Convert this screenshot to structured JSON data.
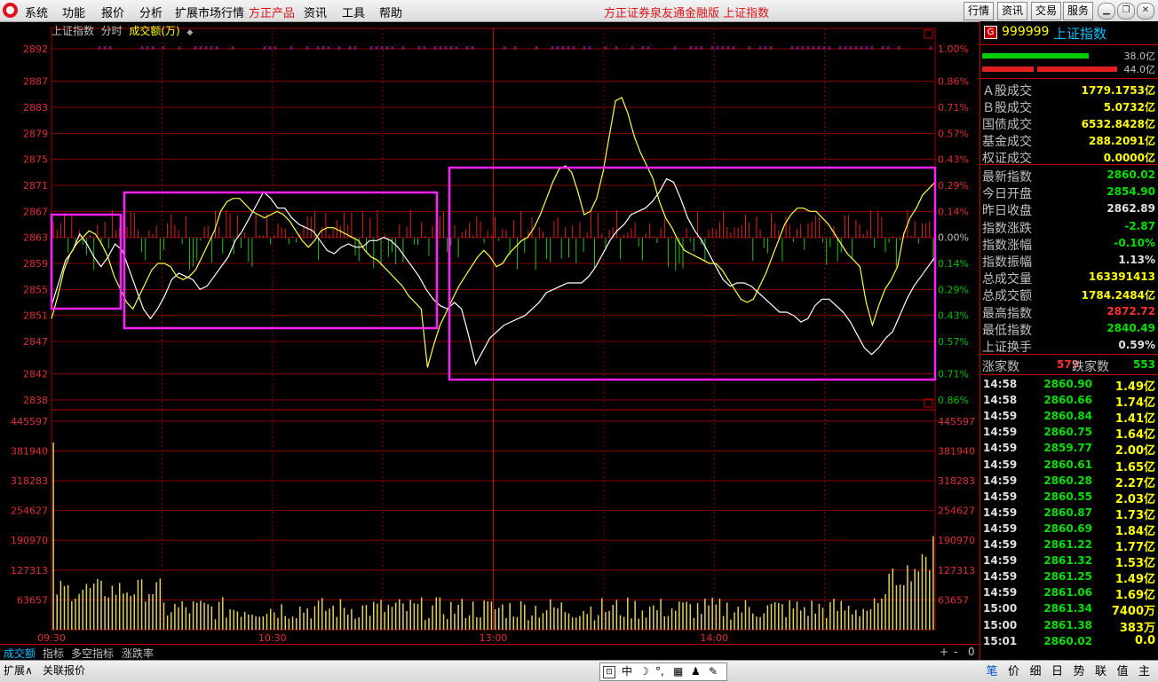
{
  "menu": {
    "items": [
      "系统",
      "功能",
      "报价",
      "分析",
      "扩展市场行情"
    ],
    "highlight": "方正产品",
    "items2": [
      "资讯",
      "工具",
      "帮助"
    ],
    "app_title": "方正证券泉友通金融版  上证指数",
    "buttons": [
      "行情",
      "资讯",
      "交易",
      "服务"
    ]
  },
  "chart_header": {
    "name": "上证指数",
    "mode": "分时",
    "series": "成交额(万)",
    "arrow": "◆"
  },
  "chart_data": {
    "type": "line",
    "price_axis": {
      "ticks": [
        2892,
        2887,
        2883,
        2879,
        2875,
        2871,
        2867,
        2863,
        2859,
        2855,
        2851,
        2847,
        2842,
        2838
      ],
      "prev_close": 2862.89,
      "range": [
        2836.5,
        2893.5
      ]
    },
    "percent_ticks": [
      "1.00%",
      "0.86%",
      "0.71%",
      "0.57%",
      "0.43%",
      "0.29%",
      "0.14%",
      "0.00%",
      "0.14%",
      "0.29%",
      "0.43%",
      "0.57%",
      "0.71%",
      "0.86%"
    ],
    "volume_axis": {
      "ticks": [
        445597,
        381940,
        318283,
        254627,
        190970,
        127313,
        63657
      ],
      "max": 470000
    },
    "time_labels": [
      "09:30",
      "10:30",
      "13:00",
      "14:00"
    ],
    "index_line": [
      2852.5,
      2856,
      2859.5,
      2861,
      2863.5,
      2862,
      2860,
      2858.5,
      2860,
      2862,
      2861,
      2858,
      2855,
      2852,
      2850.5,
      2852,
      2854,
      2856.5,
      2857.5,
      2857,
      2856.5,
      2855,
      2855.5,
      2857,
      2858.5,
      2860,
      2862.5,
      2864,
      2866,
      2868,
      2870,
      2869,
      2867.5,
      2867.5,
      2866,
      2865,
      2864.5,
      2864,
      2862.5,
      2861,
      2860.5,
      2861.5,
      2862,
      2861.5,
      2861.5,
      2862.5,
      2862.5,
      2863,
      2862.5,
      2861.5,
      2860,
      2858.5,
      2857,
      2855,
      2853.5,
      2852.5,
      2852,
      2853,
      2852,
      2848,
      2843.5,
      2845.5,
      2847.5,
      2848.5,
      2849.5,
      2850,
      2850.5,
      2851,
      2852,
      2853,
      2854.5,
      2855,
      2855.5,
      2856,
      2856,
      2856,
      2857,
      2858.5,
      2860.5,
      2862.5,
      2864,
      2865,
      2866.5,
      2867,
      2867.5,
      2868.5,
      2870,
      2872,
      2871.5,
      2869,
      2866,
      2864,
      2862.5,
      2860.5,
      2858.5,
      2856.5,
      2855.5,
      2856,
      2856,
      2855.5,
      2854.5,
      2853.5,
      2852.5,
      2851.5,
      2851.5,
      2851,
      2850,
      2850.5,
      2852.5,
      2853.5,
      2853.5,
      2852.5,
      2851.5,
      2850,
      2848,
      2846,
      2845,
      2846,
      2847.5,
      2848.5,
      2851,
      2853.5,
      2855.5,
      2857,
      2858.5,
      2860
    ],
    "avg_line": [
      2850.5,
      2854,
      2858,
      2860.5,
      2862,
      2863,
      2864,
      2863.5,
      2862,
      2860,
      2857,
      2855,
      2853,
      2852,
      2854,
      2856,
      2858,
      2859,
      2859,
      2858.5,
      2857,
      2856.5,
      2857,
      2858,
      2860,
      2862,
      2864,
      2867,
      2868.5,
      2869,
      2869,
      2868,
      2867,
      2866.5,
      2866,
      2866.5,
      2867,
      2866.5,
      2865.5,
      2864,
      2862.5,
      2861.5,
      2862.5,
      2864,
      2864.5,
      2864.5,
      2864,
      2863.5,
      2863,
      2862.5,
      2861,
      2860,
      2859.5,
      2858.5,
      2857.5,
      2856.5,
      2855.5,
      2854,
      2853,
      2852,
      2843,
      2846.5,
      2849.5,
      2851.5,
      2853.5,
      2855.5,
      2857,
      2858.5,
      2860,
      2861,
      2860,
      2858.5,
      2859,
      2860.5,
      2861.5,
      2862.5,
      2863,
      2864.5,
      2866.5,
      2869,
      2871.5,
      2873.5,
      2874,
      2873,
      2870,
      2866.5,
      2867,
      2869,
      2873,
      2878.5,
      2884,
      2884.5,
      2882,
      2878.5,
      2876,
      2874,
      2872,
      2868.5,
      2866,
      2864.5,
      2862.5,
      2861,
      2860.5,
      2860,
      2859.5,
      2859,
      2859,
      2858,
      2856.5,
      2855,
      2853.5,
      2853,
      2853.5,
      2855.5,
      2857.5,
      2860,
      2862.5,
      2865,
      2866.5,
      2867.5,
      2867.5,
      2867,
      2867,
      2866,
      2865,
      2863.5,
      2862,
      2860.5,
      2859.5,
      2858.5,
      2853,
      2849.5,
      2852.5,
      2855,
      2856.5,
      2858.5,
      2863.5,
      2866,
      2867.5,
      2869.5,
      2870.5,
      2871.5
    ]
  },
  "right_panel": {
    "code": "999999",
    "name": "上证指数",
    "badge": "G",
    "bar1": "38.0亿",
    "bar2": "44.0亿",
    "turnover": [
      {
        "label": "Ａ股成交",
        "value": "1779.1753亿",
        "color": "yellow"
      },
      {
        "label": "Ｂ股成交",
        "value": "5.0732亿",
        "color": "yellow"
      },
      {
        "label": "国债成交",
        "value": "6532.8428亿",
        "color": "yellow"
      },
      {
        "label": "基金成交",
        "value": "288.2091亿",
        "color": "yellow"
      },
      {
        "label": "权证成交",
        "value": "0.0000亿",
        "color": "yellow"
      }
    ],
    "stats": [
      {
        "label": "最新指数",
        "value": "2860.02",
        "color": "green"
      },
      {
        "label": "今日开盘",
        "value": "2854.90",
        "color": "green"
      },
      {
        "label": "昨日收盘",
        "value": "2862.89",
        "color": "white"
      },
      {
        "label": "指数涨跌",
        "value": "-2.87",
        "color": "green"
      },
      {
        "label": "指数涨幅",
        "value": "-0.10%",
        "color": "green"
      },
      {
        "label": "指数振幅",
        "value": "1.13%",
        "color": "white"
      },
      {
        "label": "总成交量",
        "value": "163391413",
        "color": "yellow"
      },
      {
        "label": "总成交额",
        "value": "1784.2484亿",
        "color": "yellow"
      },
      {
        "label": "最高指数",
        "value": "2872.72",
        "color": "red"
      },
      {
        "label": "最低指数",
        "value": "2840.49",
        "color": "green"
      },
      {
        "label": "上证换手",
        "value": "0.59%",
        "color": "white"
      }
    ],
    "advance_label": "涨家数",
    "advance_count": "579",
    "decline_label": "跌家数",
    "decline_count": "553",
    "ticks": [
      {
        "time": "14:58",
        "price": "2860.90",
        "vol": "1.49亿"
      },
      {
        "time": "14:58",
        "price": "2860.66",
        "vol": "1.74亿"
      },
      {
        "time": "14:59",
        "price": "2860.84",
        "vol": "1.41亿"
      },
      {
        "time": "14:59",
        "price": "2860.75",
        "vol": "1.64亿"
      },
      {
        "time": "14:59",
        "price": "2859.77",
        "vol": "2.00亿"
      },
      {
        "time": "14:59",
        "price": "2860.61",
        "vol": "1.65亿"
      },
      {
        "time": "14:59",
        "price": "2860.28",
        "vol": "2.27亿"
      },
      {
        "time": "14:59",
        "price": "2860.55",
        "vol": "2.03亿"
      },
      {
        "time": "14:59",
        "price": "2860.87",
        "vol": "1.73亿"
      },
      {
        "time": "14:59",
        "price": "2860.69",
        "vol": "1.84亿"
      },
      {
        "time": "14:59",
        "price": "2861.22",
        "vol": "1.77亿"
      },
      {
        "time": "14:59",
        "price": "2861.32",
        "vol": "1.53亿"
      },
      {
        "time": "14:59",
        "price": "2861.25",
        "vol": "1.49亿"
      },
      {
        "time": "14:59",
        "price": "2861.06",
        "vol": "1.69亿"
      },
      {
        "time": "15:00",
        "price": "2861.34",
        "vol": "7400万"
      },
      {
        "time": "15:00",
        "price": "2861.38",
        "vol": "383万"
      },
      {
        "time": "15:01",
        "price": "2860.02",
        "vol": "0.0"
      }
    ],
    "bottom_tabs": [
      "笔",
      "价",
      "细",
      "日",
      "势",
      "联",
      "值",
      "主"
    ]
  },
  "bottom_tabs": [
    "成交额",
    "指标",
    "多空指标",
    "涨跌率"
  ],
  "bottom_ctrl": [
    "+",
    "-",
    "0"
  ],
  "status": {
    "left1": "扩展∧",
    "left2": "关联报价",
    "ime": [
      "中",
      "☽",
      "°,",
      "▦",
      "♟",
      "✎"
    ]
  }
}
